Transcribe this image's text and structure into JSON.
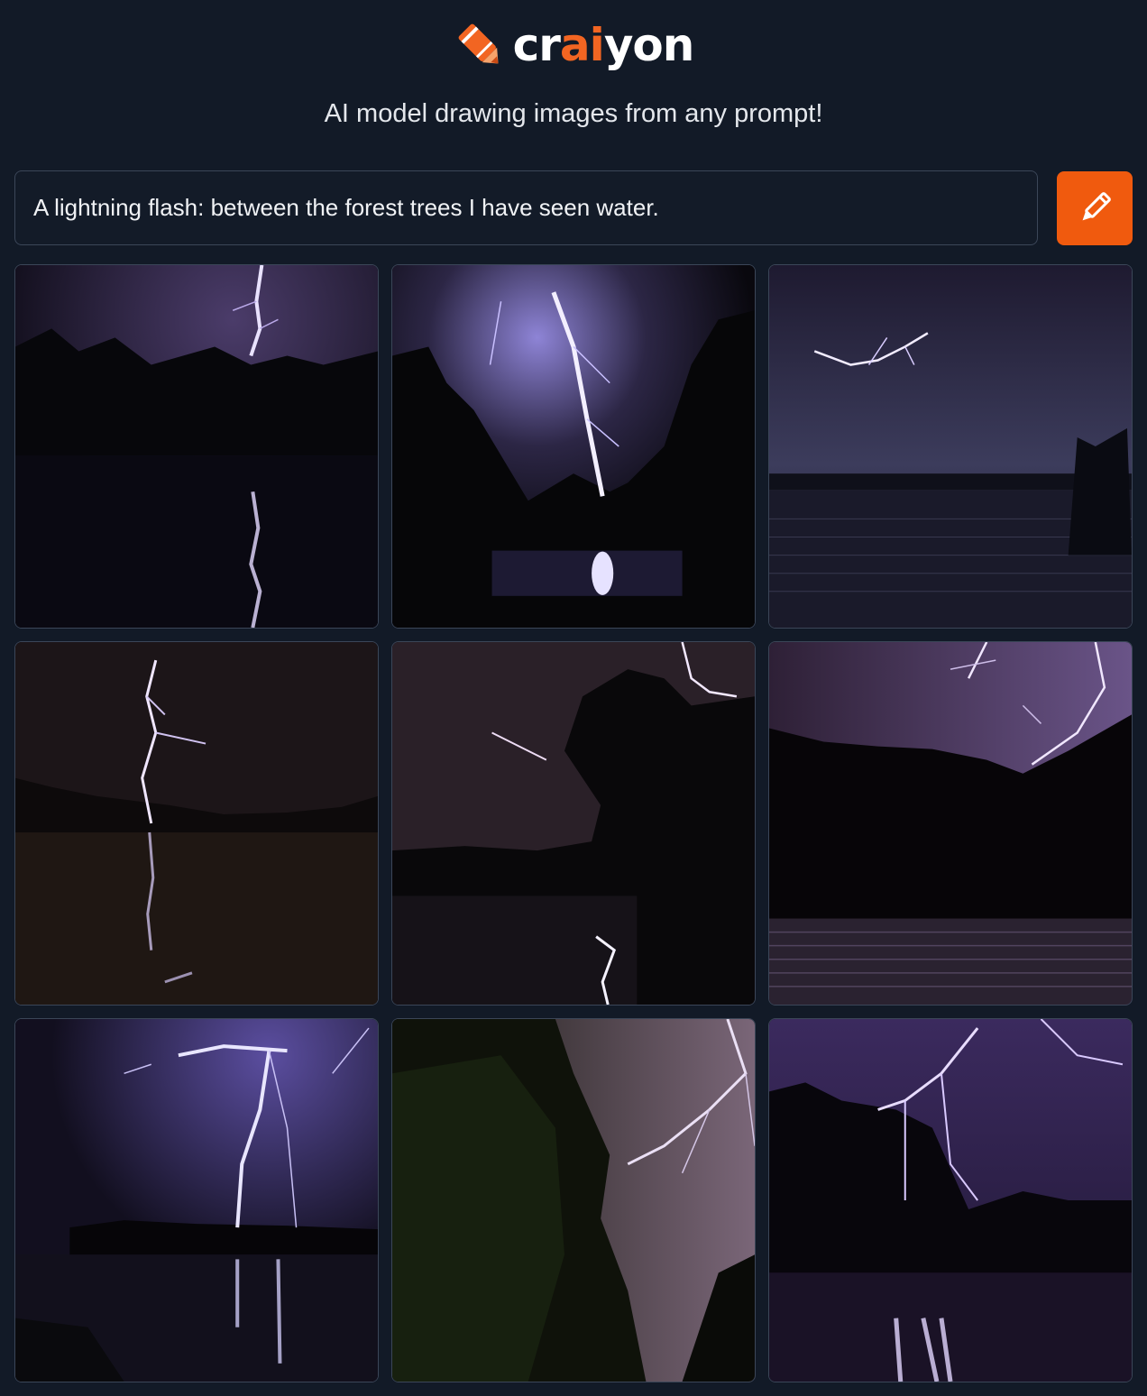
{
  "header": {
    "logo_prefix": "cr",
    "logo_highlight": "ai",
    "logo_suffix": "yon",
    "tagline": "AI model drawing images from any prompt!"
  },
  "prompt": {
    "value": "A lightning flash: between the forest trees I have seen water."
  },
  "colors": {
    "background": "#121a27",
    "accent": "#f05a0e",
    "border": "#3b4658"
  },
  "icons": {
    "logo": "crayon-icon",
    "draw_button": "pencil-icon"
  },
  "results": {
    "image_count": 9
  }
}
